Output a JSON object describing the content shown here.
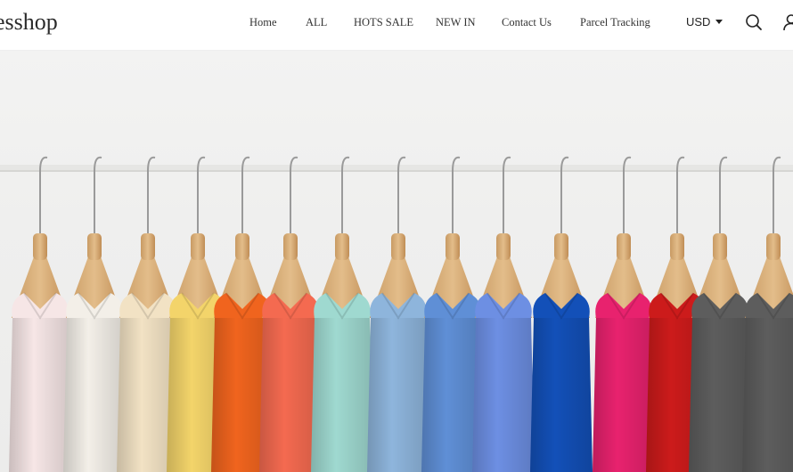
{
  "header": {
    "logo": "esshop",
    "nav": [
      "Home",
      "ALL",
      "HOTS SALE",
      "NEW IN",
      "Contact Us",
      "Parcel Tracking"
    ],
    "currency": "USD",
    "icons": {
      "search": "search-icon",
      "account": "user-icon",
      "currency_caret": "caret-down-icon"
    }
  },
  "hero": {
    "description_image": "clothing-rack-hero",
    "garment_colors": [
      "#f6e6e6",
      "#f3efe8",
      "#f2e2c4",
      "#f3d46a",
      "#f0641e",
      "#f46a50",
      "#9fd9d0",
      "#8eb5dc",
      "#5f8fd6",
      "#6d8fe3",
      "#1350b8",
      "#e8226e",
      "#cc1b1b",
      "#5d5d5d"
    ]
  }
}
